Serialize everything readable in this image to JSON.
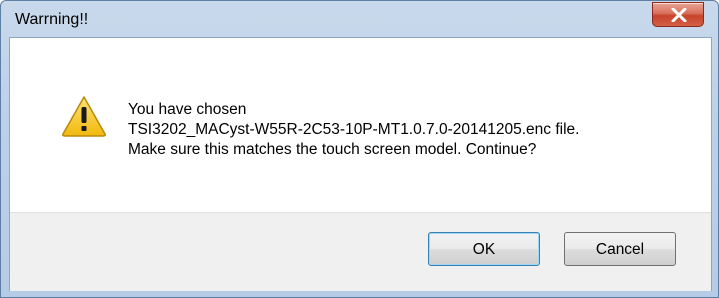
{
  "dialog": {
    "title": "Warrning!!",
    "close_icon": "close-x-icon",
    "icon": "warning-triangle-icon",
    "message_lines": [
      "You have chosen",
      "TSI3202_MACyst-W55R-2C53-10P-MT1.0.7.0-20141205.enc file.",
      "Make sure this matches the touch screen model. Continue?"
    ],
    "buttons": {
      "ok_label": "OK",
      "cancel_label": "Cancel"
    }
  },
  "colors": {
    "close_button": "#c7432b",
    "warning_fill": "#f5c518",
    "default_button_border": "#3c7fb1"
  }
}
